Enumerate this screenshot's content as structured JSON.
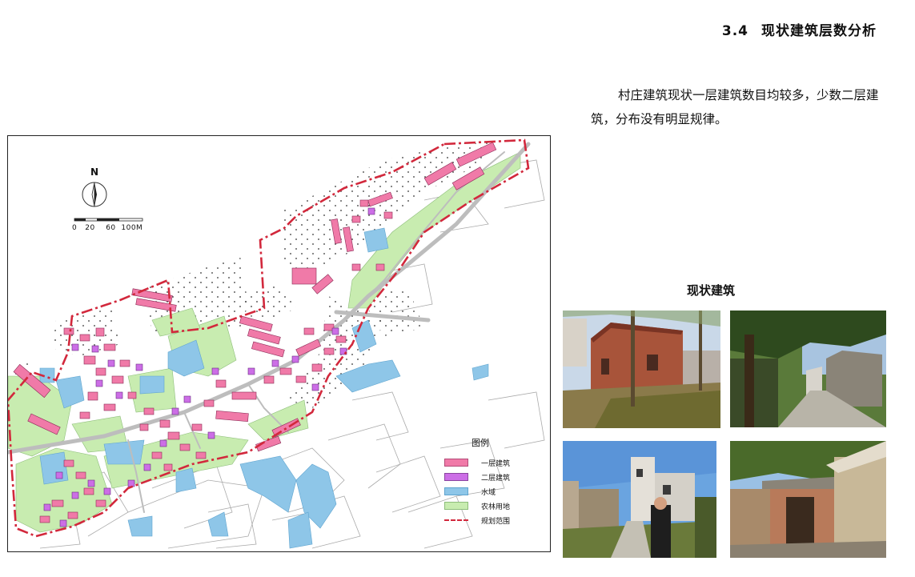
{
  "header": {
    "section_number": "3.4",
    "section_title": "现状建筑层数分析"
  },
  "description": "村庄建筑现状一层建筑数目均较多，少数二层建筑，分布没有明显规律。",
  "map": {
    "north_label": "N",
    "scale_label": "0   20    60  100M",
    "legend": {
      "title": "图例",
      "items": [
        {
          "label": "一层建筑",
          "color": "#f07aa8"
        },
        {
          "label": "二层建筑",
          "color": "#cc6ee6"
        },
        {
          "label": "水域",
          "color": "#8ec6e8"
        },
        {
          "label": "农林用地",
          "color": "#c8ecb0"
        },
        {
          "label": "规划范围",
          "color": "#d2283c"
        }
      ]
    }
  },
  "photos": {
    "title": "现状建筑",
    "items": [
      {
        "subject": "brick-house"
      },
      {
        "subject": "village-lane"
      },
      {
        "subject": "tower-house"
      },
      {
        "subject": "gate-house"
      }
    ]
  }
}
